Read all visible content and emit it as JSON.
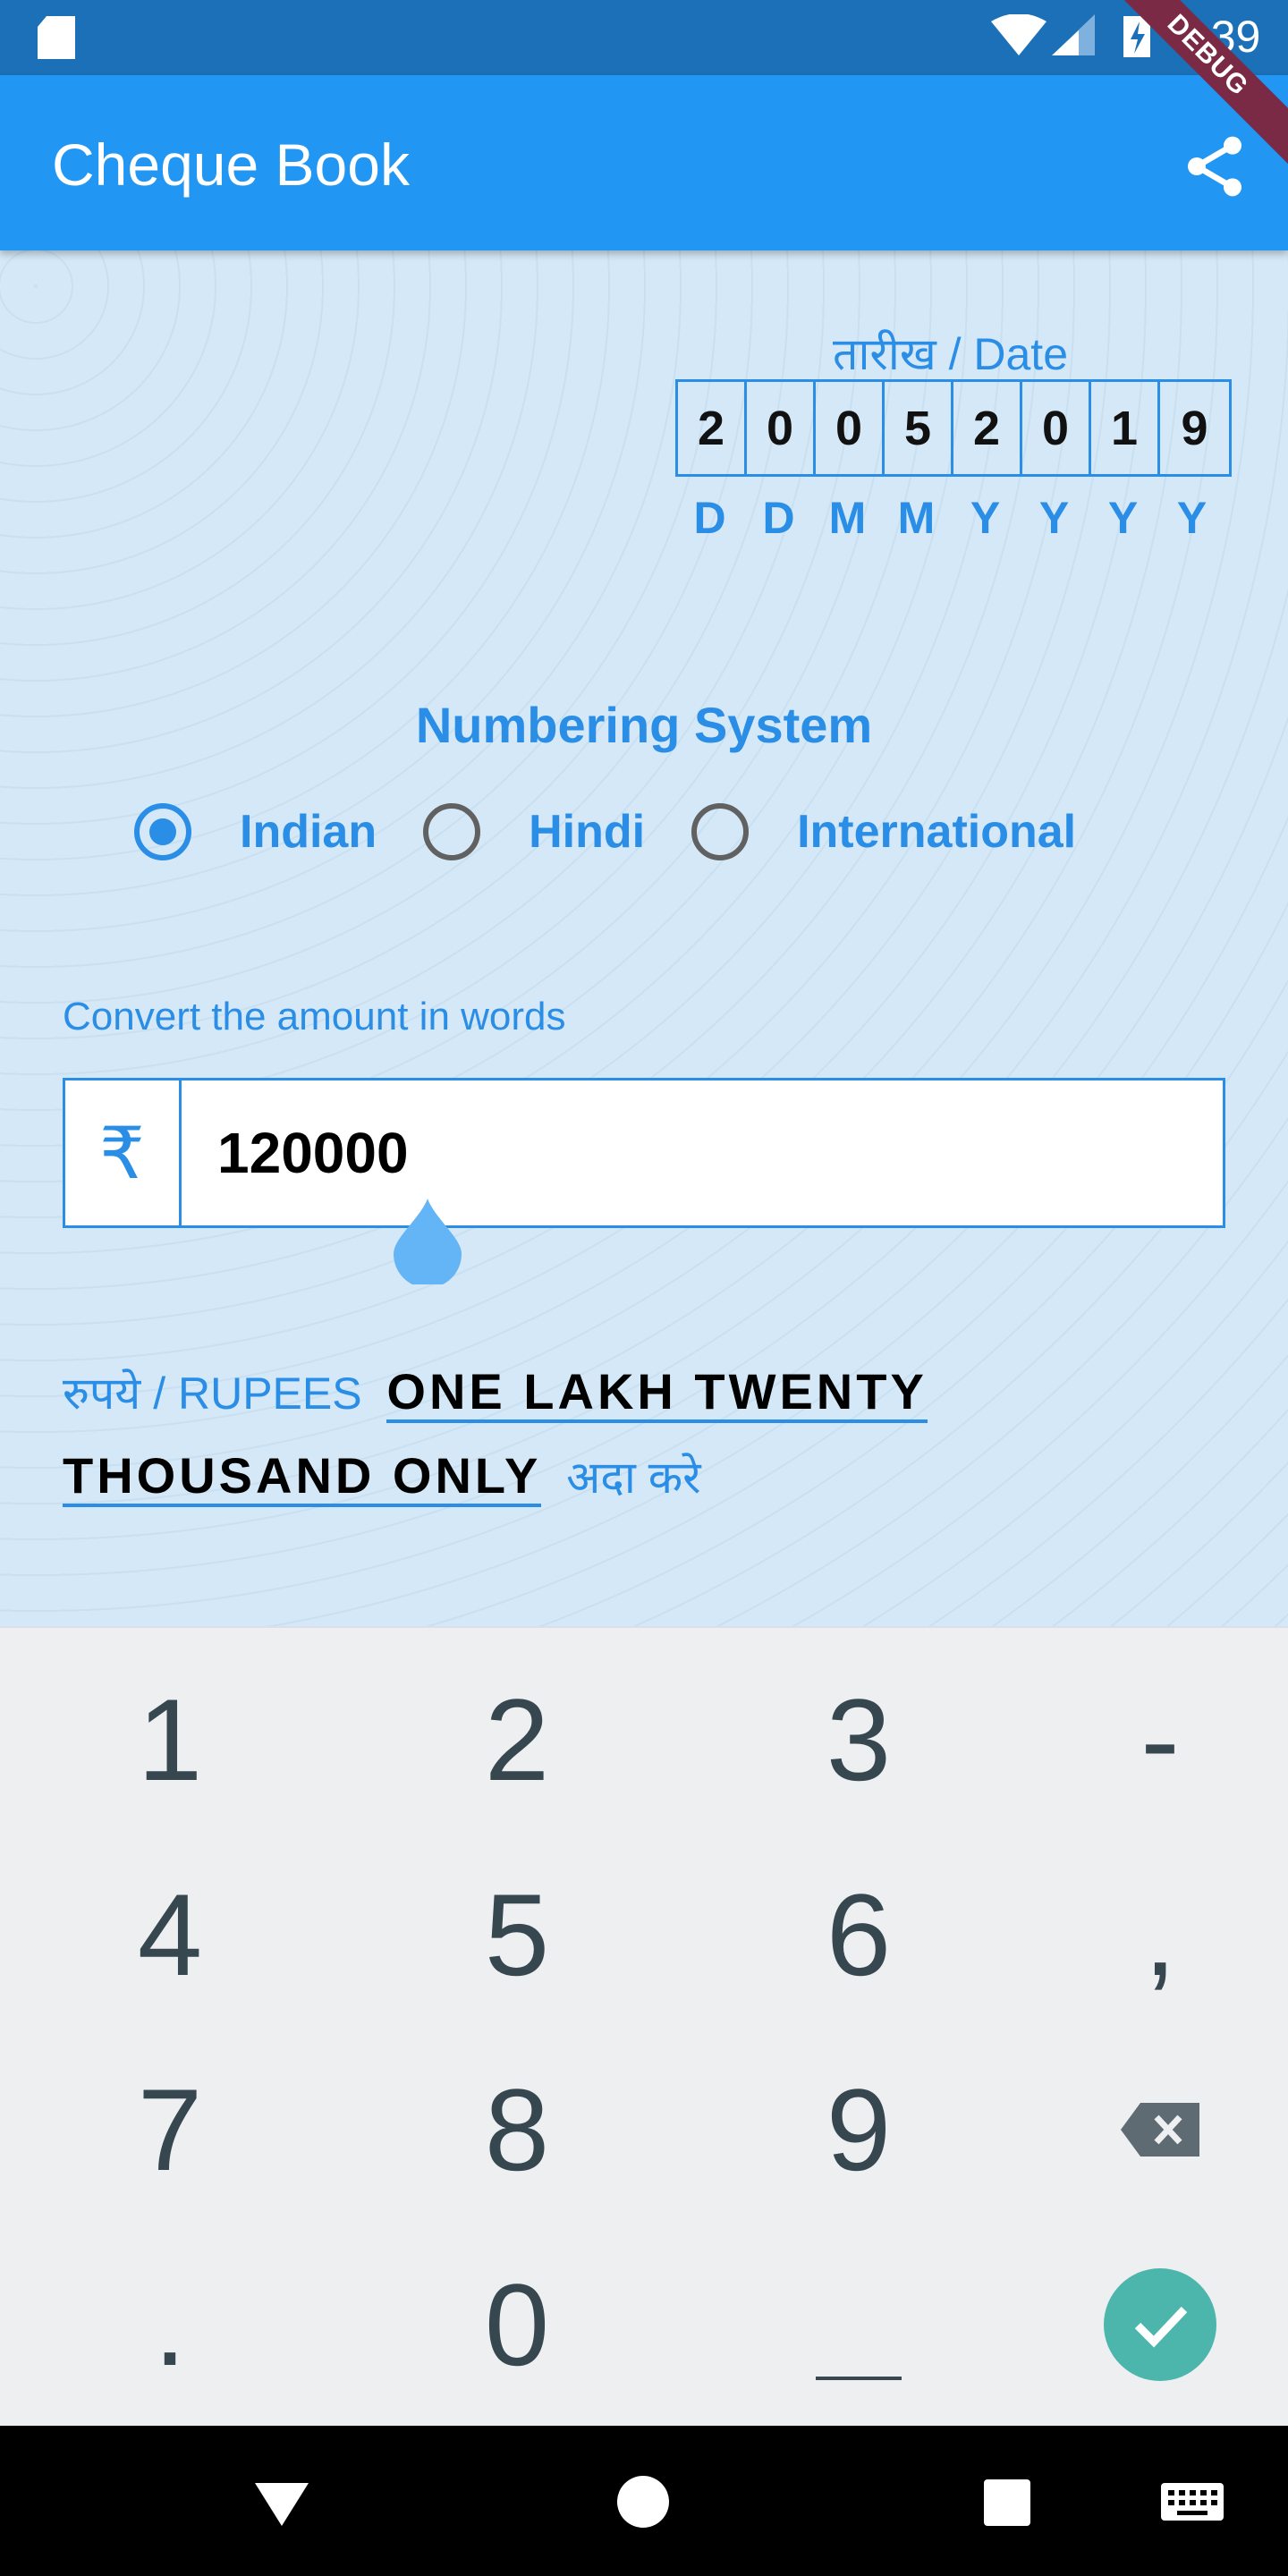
{
  "status_bar": {
    "time": "9:39",
    "icons": [
      "sd-card-icon",
      "wifi-icon",
      "signal-icon",
      "battery-charging-icon"
    ]
  },
  "debug_banner": "DEBUG",
  "app_bar": {
    "title": "Cheque Book",
    "action_icon": "share-icon"
  },
  "date": {
    "label": "तारीख / Date",
    "digits": [
      "2",
      "0",
      "0",
      "5",
      "2",
      "0",
      "1",
      "9"
    ],
    "format": [
      "D",
      "D",
      "M",
      "M",
      "Y",
      "Y",
      "Y",
      "Y"
    ]
  },
  "numbering": {
    "title": "Numbering System",
    "options": [
      {
        "label": "Indian",
        "selected": true
      },
      {
        "label": "Hindi",
        "selected": false
      },
      {
        "label": "International",
        "selected": false
      }
    ]
  },
  "amount": {
    "label": "Convert the amount in words",
    "currency_symbol": "₹",
    "value": "120000"
  },
  "words": {
    "prefix": "रुपये / RUPEES",
    "line1": "ONE LAKH TWENTY ",
    "line2": "THOUSAND ONLY",
    "suffix": "अदा करे"
  },
  "keyboard": {
    "keys": [
      "1",
      "2",
      "3",
      "-",
      "4",
      "5",
      "6",
      ",",
      "7",
      "8",
      "9",
      "backspace",
      ".",
      "0",
      "_",
      "done"
    ]
  },
  "colors": {
    "primary": "#2196f3",
    "accent": "#2a8de6",
    "done_key": "#4db6ac"
  },
  "nav_bar": {
    "icons": [
      "back-icon",
      "home-icon",
      "recents-icon",
      "keyboard-icon"
    ]
  }
}
